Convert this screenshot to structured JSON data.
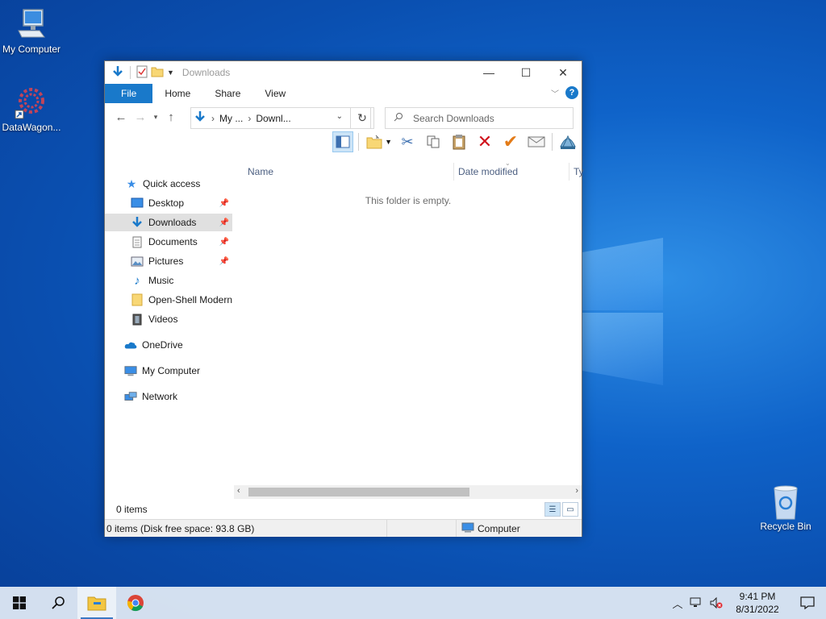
{
  "desktop": {
    "icons": [
      {
        "label": "My Computer"
      },
      {
        "label": "DataWagon..."
      },
      {
        "label": "Recycle Bin"
      }
    ]
  },
  "window": {
    "title": "Downloads",
    "ribbon_tabs": [
      "File",
      "Home",
      "Share",
      "View"
    ],
    "address": {
      "crumbs": [
        "My ...",
        "Downl..."
      ]
    },
    "search": {
      "placeholder": "Search Downloads"
    },
    "nav": {
      "quick_access": "Quick access",
      "items": [
        "Desktop",
        "Downloads",
        "Documents",
        "Pictures",
        "Music",
        "Open-Shell Modern",
        "Videos"
      ],
      "onedrive": "OneDrive",
      "my_computer": "My Computer",
      "network": "Network"
    },
    "columns": [
      "Name",
      "Date modified",
      "Ty"
    ],
    "empty_message": "This folder is empty.",
    "item_count": "0 items",
    "status": {
      "info": "0 items (Disk free space: 93.8 GB)",
      "location": "Computer"
    }
  },
  "taskbar": {
    "time": "9:41 PM",
    "date": "8/31/2022"
  },
  "colors": {
    "accent": "#1979ca",
    "selection": "#cce4f7",
    "desktop": "#0f63c9"
  }
}
